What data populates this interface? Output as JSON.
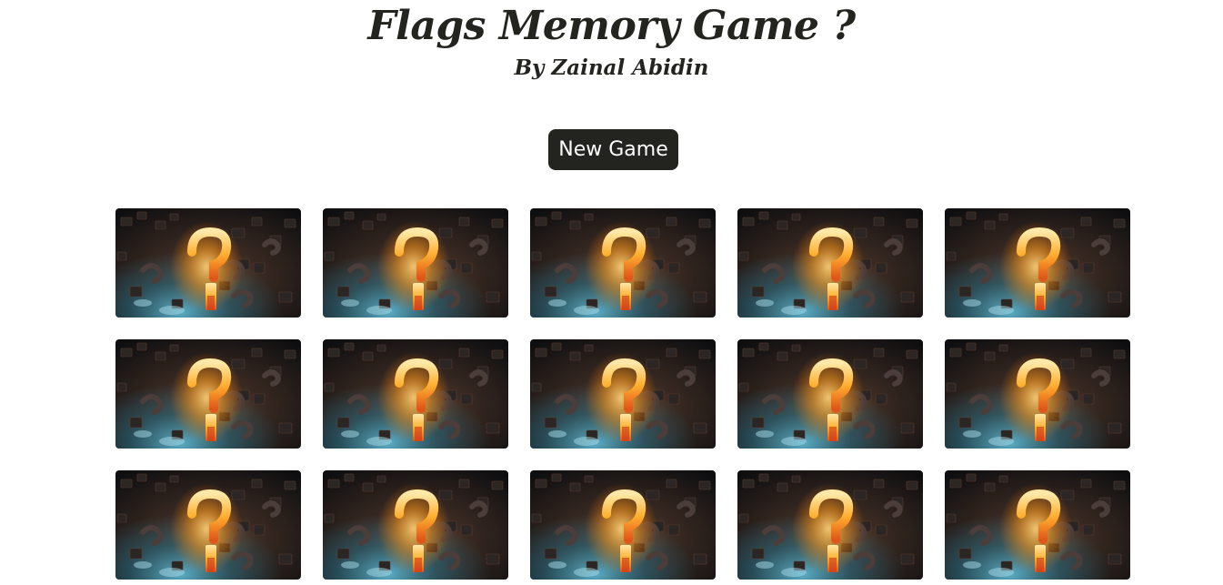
{
  "header": {
    "title": "Flags Memory Game ?",
    "subtitle": "By Zainal Abidin"
  },
  "controls": {
    "new_game_label": "New Game"
  },
  "board": {
    "rows": 3,
    "columns": 5,
    "cards": [
      {
        "state": "face-down",
        "icon": "question-mark-icon"
      },
      {
        "state": "face-down",
        "icon": "question-mark-icon"
      },
      {
        "state": "face-down",
        "icon": "question-mark-icon"
      },
      {
        "state": "face-down",
        "icon": "question-mark-icon"
      },
      {
        "state": "face-down",
        "icon": "question-mark-icon"
      },
      {
        "state": "face-down",
        "icon": "question-mark-icon"
      },
      {
        "state": "face-down",
        "icon": "question-mark-icon"
      },
      {
        "state": "face-down",
        "icon": "question-mark-icon"
      },
      {
        "state": "face-down",
        "icon": "question-mark-icon"
      },
      {
        "state": "face-down",
        "icon": "question-mark-icon"
      },
      {
        "state": "face-down",
        "icon": "question-mark-icon"
      },
      {
        "state": "face-down",
        "icon": "question-mark-icon"
      },
      {
        "state": "face-down",
        "icon": "question-mark-icon"
      },
      {
        "state": "face-down",
        "icon": "question-mark-icon"
      },
      {
        "state": "face-down",
        "icon": "question-mark-icon"
      }
    ]
  },
  "colors": {
    "text": "#23241f",
    "button_bg": "#23241f",
    "button_text": "#ffffff",
    "card_glow": "#ffa31a",
    "card_teal": "#3f8fa8",
    "card_dark": "#141414"
  }
}
